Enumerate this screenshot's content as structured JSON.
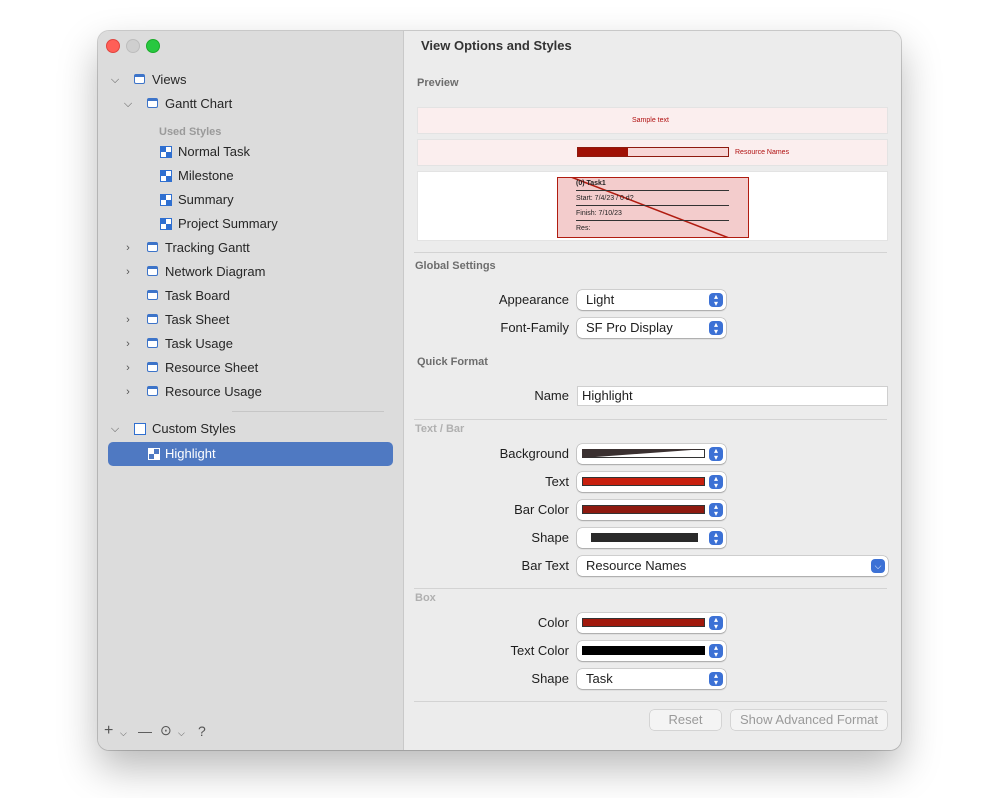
{
  "sidebar": {
    "views_label": "Views",
    "gantt_label": "Gantt Chart",
    "used_styles_label": "Used Styles",
    "used_styles": [
      "Normal Task",
      "Milestone",
      "Summary",
      "Project Summary"
    ],
    "other_views": [
      "Tracking Gantt",
      "Network Diagram",
      "Task Board",
      "Task Sheet",
      "Task Usage",
      "Resource Sheet",
      "Resource Usage"
    ],
    "custom_styles_label": "Custom Styles",
    "selected_item": "Highlight",
    "bottom_icons": [
      "plus-icon",
      "chevron-down-icon",
      "minus-icon",
      "ellipsis-circle-icon",
      "chevron-down-icon",
      "question-icon"
    ],
    "bottom_plus": "+",
    "bottom_minus": "—",
    "bottom_more": "⊙",
    "bottom_help": "?"
  },
  "main": {
    "title": "View Options and Styles",
    "preview_label": "Preview",
    "preview": {
      "sample_text": "Sample text",
      "bar_label": "Resource Names",
      "box_task": "(0) Task1",
      "box_start": "Start: 7/4/23 / 0 d?",
      "box_finish": "Finish: 7/10/23",
      "box_res": "Res:"
    },
    "global_settings_label": "Global Settings",
    "appearance_label": "Appearance",
    "appearance_value": "Light",
    "font_family_label": "Font-Family",
    "font_family_value": "SF Pro Display",
    "quick_format_label": "Quick Format",
    "name_label": "Name",
    "name_value": "Highlight",
    "text_bar_label": "Text / Bar",
    "background_label": "Background",
    "text_label": "Text",
    "bar_color_label": "Bar Color",
    "shape_label": "Shape",
    "bar_text_label": "Bar Text",
    "bar_text_value": "Resource Names",
    "box_label": "Box",
    "box_color_label": "Color",
    "box_text_color_label": "Text Color",
    "box_shape_label": "Shape",
    "box_shape_value": "Task",
    "reset_label": "Reset",
    "advanced_label": "Show Advanced Format"
  },
  "colors": {
    "accent": "#3c71d5",
    "selection": "#4f79c2",
    "text_swatch": "#c8200e",
    "bar_swatch": "#8e1a10",
    "box_color_swatch": "#a0180c",
    "box_text_swatch": "#000000",
    "shape_swatch": "#2a2a2a"
  }
}
